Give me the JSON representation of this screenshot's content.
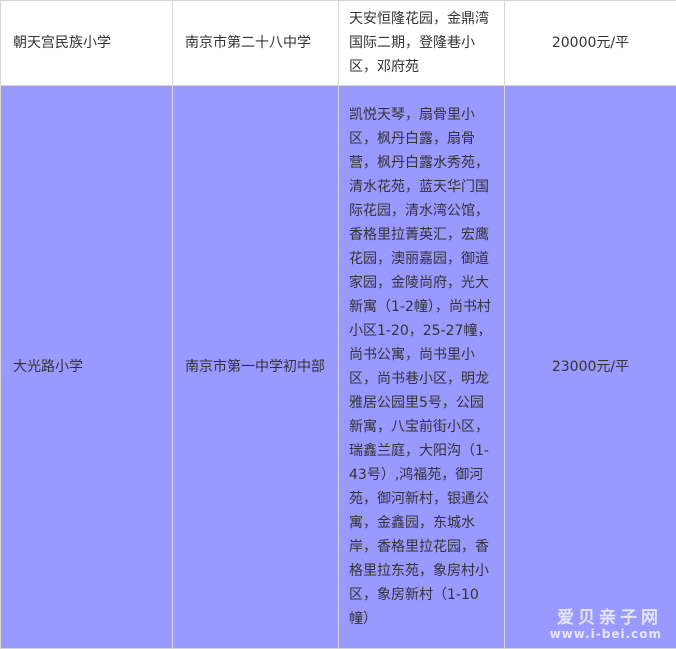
{
  "rows": [
    {
      "school": "朝天宫民族小学",
      "middle_school": "南京市第二十八中学",
      "communities": "天安恒隆花园，金鼎湾国际二期，登隆巷小区，邓府苑",
      "price": "20000元/平"
    },
    {
      "school": "大光路小学",
      "middle_school": "南京市第一中学初中部",
      "communities": "凯悦天琴，扇骨里小区，枫丹白露，扇骨营，枫丹白露水秀苑，清水花苑，蓝天华门国际花园，清水湾公馆，香格里拉菁英汇，宏鹰花园，澳丽嘉园，御道家园，金陵尚府，光大新寓（1-2幢），尚书村小区1-20，25-27幢，尚书公寓，尚书里小区，尚书巷小区，明龙雅居公园里5号，公园新寓，八宝前街小区，瑞鑫兰庭，大阳沟（1-43号）,鸿福苑，御河苑，御河新村，银通公寓，金鑫园，东城水岸，香格里拉花园，香格里拉东苑，象房村小区，象房新村（1-10幢）",
      "price": "23000元/平"
    }
  ],
  "watermark": {
    "name": "爱贝亲子网",
    "url": "www.i-bei.com"
  },
  "colors": {
    "highlight_row": "#9999ff",
    "border": "#d6d6d6"
  }
}
